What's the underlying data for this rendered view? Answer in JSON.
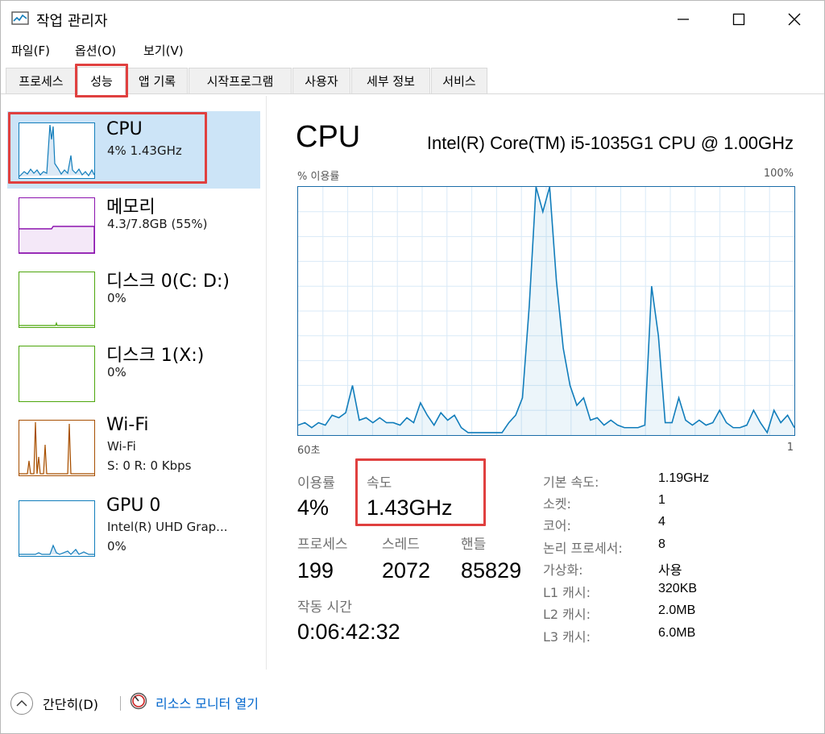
{
  "window": {
    "title": "작업 관리자"
  },
  "menu": [
    "파일(F)",
    "옵션(O)",
    "보기(V)"
  ],
  "tabs": [
    "프로세스",
    "성능",
    "앱 기록",
    "시작프로그램",
    "사용자",
    "세부 정보",
    "서비스"
  ],
  "active_tab": "성능",
  "sidebar": {
    "items": [
      {
        "title": "CPU",
        "sub1": "4%  1.43GHz",
        "sub2": "",
        "color": "#117dbb",
        "selected": true
      },
      {
        "title": "메모리",
        "sub1": "4.3/7.8GB (55%)",
        "sub2": "",
        "color": "#8b12ae",
        "selected": false
      },
      {
        "title": "디스크 0(C: D:)",
        "sub1": "0%",
        "sub2": "",
        "color": "#4da60c",
        "selected": false
      },
      {
        "title": "디스크 1(X:)",
        "sub1": "0%",
        "sub2": "",
        "color": "#4da60c",
        "selected": false
      },
      {
        "title": "Wi-Fi",
        "sub1": "Wi-Fi",
        "sub2": "S: 0  R: 0 Kbps",
        "color": "#a74f01",
        "selected": false
      },
      {
        "title": "GPU 0",
        "sub1": "Intel(R) UHD Grap...",
        "sub2": "0%",
        "color": "#117dbb",
        "selected": false
      }
    ]
  },
  "cpu": {
    "heading": "CPU",
    "model": "Intel(R) Core(TM) i5-1035G1 CPU @ 1.00GHz",
    "chart_top_left": "% 이용률",
    "chart_top_right": "100%",
    "chart_bottom_left": "60초",
    "chart_bottom_right": "1",
    "line_color": "#117dbb",
    "utilization_history": [
      4,
      5,
      3,
      5,
      4,
      8,
      7,
      9,
      20,
      6,
      7,
      5,
      7,
      5,
      5,
      4,
      7,
      5,
      13,
      8,
      4,
      9,
      6,
      8,
      3,
      1,
      1,
      1,
      1,
      1,
      1,
      5,
      8,
      15,
      52,
      100,
      90,
      100,
      62,
      35,
      20,
      12,
      15,
      6,
      7,
      4,
      6,
      4,
      3,
      3,
      3,
      4,
      60,
      40,
      5,
      5,
      15,
      6,
      4,
      6,
      4,
      5,
      10,
      5,
      3,
      3,
      4,
      10,
      5,
      1,
      10,
      5,
      8,
      3
    ],
    "stats": {
      "utilization_label": "이용률",
      "utilization_value": "4%",
      "speed_label": "속도",
      "speed_value": "1.43GHz",
      "processes_label": "프로세스",
      "processes_value": "199",
      "threads_label": "스레드",
      "threads_value": "2072",
      "handles_label": "핸들",
      "handles_value": "85829",
      "uptime_label": "작동 시간",
      "uptime_value": "0:06:42:32"
    },
    "specs": [
      {
        "label": "기본 속도:",
        "value": "1.19GHz"
      },
      {
        "label": "소켓:",
        "value": "1"
      },
      {
        "label": "코어:",
        "value": "4"
      },
      {
        "label": "논리 프로세서:",
        "value": "8"
      },
      {
        "label": "가상화:",
        "value": "사용"
      },
      {
        "label": "L1 캐시:",
        "value": "320KB"
      },
      {
        "label": "L2 캐시:",
        "value": "2.0MB"
      },
      {
        "label": "L3 캐시:",
        "value": "6.0MB"
      }
    ]
  },
  "footer": {
    "fewer_details": "간단히(D)",
    "open_resource_monitor": "리소스 모니터 열기"
  },
  "highlight_color": "#e0403f"
}
